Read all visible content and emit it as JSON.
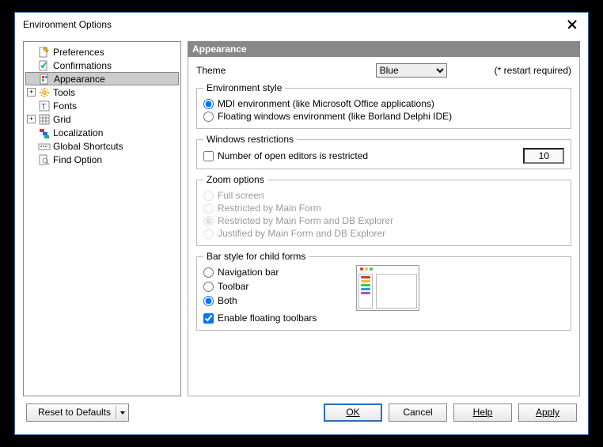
{
  "window": {
    "title": "Environment Options"
  },
  "tree": {
    "items": [
      {
        "label": "Preferences",
        "indent": 1,
        "icon": "page-pencil"
      },
      {
        "label": "Confirmations",
        "indent": 1,
        "icon": "page-check"
      },
      {
        "label": "Appearance",
        "indent": 1,
        "icon": "page-colors",
        "selected": true
      },
      {
        "label": "Tools",
        "indent": 1,
        "icon": "gear",
        "expandable": true
      },
      {
        "label": "Fonts",
        "indent": 1,
        "icon": "font-t"
      },
      {
        "label": "Grid",
        "indent": 1,
        "icon": "grid",
        "expandable": true
      },
      {
        "label": "Localization",
        "indent": 1,
        "icon": "flags"
      },
      {
        "label": "Global Shortcuts",
        "indent": 1,
        "icon": "keyboard"
      },
      {
        "label": "Find Option",
        "indent": 1,
        "icon": "find"
      }
    ]
  },
  "page": {
    "title": "Appearance",
    "theme_label": "Theme",
    "theme_value": "Blue",
    "restart_note": "(* restart required)",
    "env_style": {
      "legend": "Environment style",
      "mdi": "MDI environment (like Microsoft Office applications)",
      "floating": "Floating windows environment (like Borland Delphi IDE)",
      "selected": "mdi"
    },
    "restrictions": {
      "legend": "Windows restrictions",
      "num_editors_label": "Number of open editors is restricted",
      "num_editors_checked": false,
      "num_editors_value": "10"
    },
    "zoom": {
      "legend": "Zoom options",
      "full": "Full screen",
      "by_main": "Restricted by Main Form",
      "by_main_db": "Restricted by Main Form and DB Explorer",
      "justified": "Justified by Main Form and DB Explorer",
      "selected": "by_main_db"
    },
    "barstyle": {
      "legend": "Bar style for child forms",
      "nav": "Navigation bar",
      "toolbar": "Toolbar",
      "both": "Both",
      "selected": "both",
      "enable_floating_label": "Enable floating toolbars",
      "enable_floating_checked": true
    }
  },
  "footer": {
    "reset": "Reset to Defaults",
    "ok": "OK",
    "cancel": "Cancel",
    "help": "Help",
    "apply": "Apply"
  }
}
